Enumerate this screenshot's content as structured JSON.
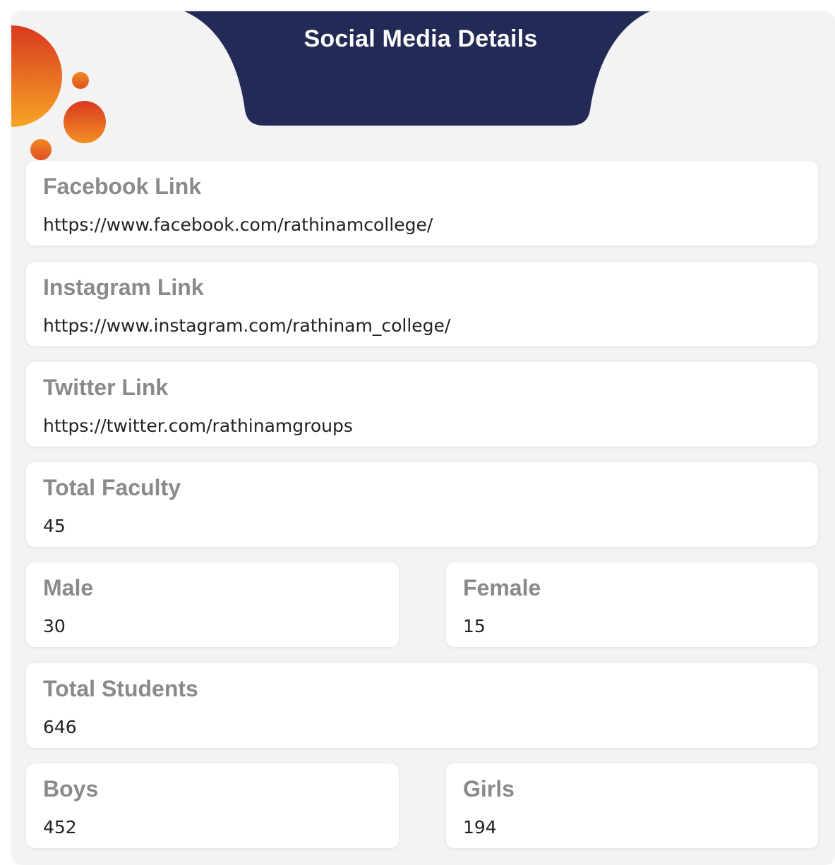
{
  "header": {
    "title": "Social Media Details"
  },
  "colors": {
    "header_bg": "#232a55",
    "bubble_orange": "#f39a22",
    "bubble_red": "#d9381f",
    "label_gray": "#8a8a8a"
  },
  "fields": {
    "facebook": {
      "label": "Facebook Link",
      "value": "https://www.facebook.com/rathinamcollege/"
    },
    "instagram": {
      "label": "Instagram Link",
      "value": "https://www.instagram.com/rathinam_college/"
    },
    "twitter": {
      "label": "Twitter Link",
      "value": "https://twitter.com/rathinamgroups"
    },
    "total_faculty": {
      "label": "Total Faculty",
      "value": "45"
    },
    "male": {
      "label": "Male",
      "value": "30"
    },
    "female": {
      "label": "Female",
      "value": "15"
    },
    "total_students": {
      "label": "Total Students",
      "value": "646"
    },
    "boys": {
      "label": "Boys",
      "value": "452"
    },
    "girls": {
      "label": "Girls",
      "value": "194"
    }
  }
}
